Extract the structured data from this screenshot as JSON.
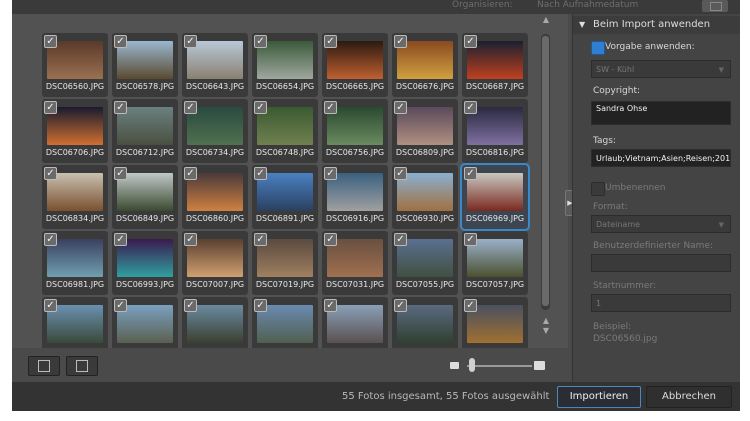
{
  "topbar": {
    "organize_label": "Organisieren:",
    "sort_value": "Nach Aufnahmedatum"
  },
  "thumbnails": [
    {
      "name": "DSC06560.JPG",
      "checked": true,
      "c1": "#5a3a2a",
      "c2": "#9a7050"
    },
    {
      "name": "DSC06578.JPG",
      "checked": true,
      "c1": "#9ab8d0",
      "c2": "#5a4a30"
    },
    {
      "name": "DSC06643.JPG",
      "checked": true,
      "c1": "#b8c8d8",
      "c2": "#8a8070"
    },
    {
      "name": "DSC06654.JPG",
      "checked": true,
      "c1": "#3a5a3a",
      "c2": "#a0a8a0"
    },
    {
      "name": "DSC06665.JPG",
      "checked": true,
      "c1": "#2a1a10",
      "c2": "#c06030"
    },
    {
      "name": "DSC06676.JPG",
      "checked": true,
      "c1": "#8a4a20",
      "c2": "#d0a040"
    },
    {
      "name": "DSC06687.JPG",
      "checked": true,
      "c1": "#1a2030",
      "c2": "#c04020"
    },
    {
      "name": "DSC06706.JPG",
      "checked": true,
      "c1": "#1a1a30",
      "c2": "#d07030"
    },
    {
      "name": "DSC06712.JPG",
      "checked": true,
      "c1": "#6a8080",
      "c2": "#4a5040"
    },
    {
      "name": "DSC06734.JPG",
      "checked": true,
      "c1": "#2a4a40",
      "c2": "#507050"
    },
    {
      "name": "DSC06748.JPG",
      "checked": true,
      "c1": "#3a5a30",
      "c2": "#708050"
    },
    {
      "name": "DSC06756.JPG",
      "checked": true,
      "c1": "#2a4a30",
      "c2": "#6a8a60"
    },
    {
      "name": "DSC06809.JPG",
      "checked": true,
      "c1": "#5a4a5a",
      "c2": "#b09080"
    },
    {
      "name": "DSC06816.JPG",
      "checked": true,
      "c1": "#2a2a40",
      "c2": "#8070a0"
    },
    {
      "name": "DSC06834.JPG",
      "checked": true,
      "c1": "#c8c0b0",
      "c2": "#7a5030"
    },
    {
      "name": "DSC06849.JPG",
      "checked": true,
      "c1": "#c0c8c8",
      "c2": "#3a4a30"
    },
    {
      "name": "DSC06860.JPG",
      "checked": true,
      "c1": "#4a3a3a",
      "c2": "#d08040"
    },
    {
      "name": "DSC06891.JPG",
      "checked": true,
      "c1": "#4a80c0",
      "c2": "#2a4060"
    },
    {
      "name": "DSC06916.JPG",
      "checked": true,
      "c1": "#3a6080",
      "c2": "#a0a0a0"
    },
    {
      "name": "DSC06930.JPG",
      "checked": true,
      "c1": "#8ab0d0",
      "c2": "#a07040"
    },
    {
      "name": "DSC06969.JPG",
      "checked": true,
      "selected": true,
      "c1": "#c8c8c0",
      "c2": "#7a2a20"
    },
    {
      "name": "DSC06981.JPG",
      "checked": true,
      "c1": "#3a4060",
      "c2": "#70a0b0"
    },
    {
      "name": "DSC06993.JPG",
      "checked": true,
      "c1": "#3a1a50",
      "c2": "#30a0a0"
    },
    {
      "name": "DSC07007.JPG",
      "checked": true,
      "c1": "#5a4030",
      "c2": "#d0a070"
    },
    {
      "name": "DSC07019.JPG",
      "checked": true,
      "c1": "#5a4a40",
      "c2": "#a08060"
    },
    {
      "name": "DSC07031.JPG",
      "checked": true,
      "c1": "#6a5040",
      "c2": "#a07050"
    },
    {
      "name": "DSC07055.JPG",
      "checked": true,
      "c1": "#5a7090",
      "c2": "#405040"
    },
    {
      "name": "DSC07057.JPG",
      "checked": true,
      "c1": "#9ab0c8",
      "c2": "#4a5030"
    },
    {
      "name": "",
      "checked": true,
      "c1": "#6a90b0",
      "c2": "#3a4a3a"
    },
    {
      "name": "",
      "checked": true,
      "c1": "#7aa0c0",
      "c2": "#5a6050"
    },
    {
      "name": "",
      "checked": true,
      "c1": "#6a8aa0",
      "c2": "#3a4030"
    },
    {
      "name": "",
      "checked": true,
      "c1": "#6a8ab0",
      "c2": "#506050"
    },
    {
      "name": "",
      "checked": true,
      "c1": "#8aa0b8",
      "c2": "#5a5050"
    },
    {
      "name": "",
      "checked": true,
      "c1": "#5a6a80",
      "c2": "#304030"
    },
    {
      "name": "",
      "checked": true,
      "c1": "#4a5060",
      "c2": "#a07030"
    }
  ],
  "panel": {
    "header": "Beim Import anwenden",
    "preset_label": "Vorgabe anwenden:",
    "preset_value": "SW - Kühl",
    "copyright_label": "Copyright:",
    "copyright_value": "Sandra Ohse",
    "tags_label": "Tags:",
    "tags_value": "Urlaub;Vietnam;Asien;Reisen;201",
    "rename_label": "Umbenennen",
    "format_label": "Format:",
    "format_value": "Dateiname",
    "custom_name_label": "Benutzerdefinierter Name:",
    "custom_name_value": "",
    "start_label": "Startnummer:",
    "start_value": "1",
    "example_label": "Beispiel:",
    "example_value": "DSC06560.jpg"
  },
  "footer": {
    "status": "55 Fotos insgesamt, 55 Fotos ausgewählt",
    "import_button": "Importieren",
    "cancel_button": "Abbrechen"
  },
  "colors": {
    "accent": "#3b88c8",
    "checkbox_blue": "#2f7fd0"
  }
}
